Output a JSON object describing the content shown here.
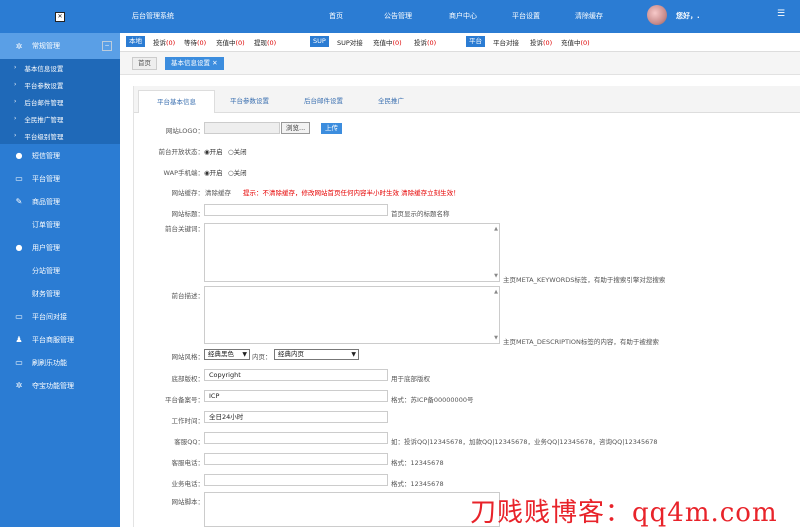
{
  "sidebar": {
    "logo_icon": "x-box-icon",
    "main": "常规管理",
    "sub": [
      "基本信息设置",
      "平台参数设置",
      "后台邮件管理",
      "全民推广管理",
      "平台级别管理"
    ],
    "items": [
      "短信管理",
      "平台管理",
      "商品管理",
      "订单管理",
      "用户管理",
      "分站管理",
      "财务管理",
      "平台间对接",
      "平台商服管理",
      "刷刷乐功能",
      "夺宝功能管理"
    ],
    "colors": {
      "bg": "#2b7cd3",
      "active": "#5a9fe6",
      "sub_bg": "#1f69b8"
    }
  },
  "topbar": {
    "title": "后台管理系统",
    "nav": [
      "首页",
      "公告管理",
      "商户中心",
      "平台设置",
      "清除缓存"
    ],
    "greeting": "您好，.",
    "menu_icon": "hamburger-icon"
  },
  "statusbar": {
    "local_tag": "本地",
    "local_items": [
      {
        "label": "投诉",
        "count": "(0)"
      },
      {
        "label": "等待",
        "count": "(0)"
      },
      {
        "label": "充值中",
        "count": "(0)"
      },
      {
        "label": "提现",
        "count": "(0)"
      }
    ],
    "sup_tag": "SUP",
    "sup_items": [
      {
        "label": "SUP对接",
        "count": ""
      },
      {
        "label": "充值中",
        "count": "(0)"
      },
      {
        "label": "投诉",
        "count": "(0)"
      }
    ],
    "plat_tag": "平台",
    "plat_items": [
      {
        "label": "平台对接",
        "count": ""
      },
      {
        "label": "投诉",
        "count": "(0)"
      },
      {
        "label": "充值中",
        "count": "(0)"
      }
    ]
  },
  "breadcrumb": {
    "home": "首页",
    "current": "基本信息设置 ✕"
  },
  "tabs": [
    "平台基本信息",
    "平台参数设置",
    "后台邮件设置",
    "全民推广"
  ],
  "form": {
    "logo_label": "网站LOGO：",
    "browse": "浏览...",
    "upload": "上传",
    "open_label": "前台开放状态：",
    "wap_label": "WAP手机端：",
    "radio_on": "开启",
    "radio_off": "关闭",
    "cache_label": "网站缓存：",
    "cache_value": "清除缓存",
    "cache_tip": "提示：不清除缓存，修改网站首页任何内容半小时生效 清除缓存立刻生效！",
    "title_label": "网站标题：",
    "title_hint": "首页显示的标题名称",
    "keywords_label": "前台关键词：",
    "keywords_hint": "主页META_KEYWORDS标签，有助于搜索引擎对您搜索",
    "desc_label": "前台描述：",
    "desc_hint": "主页META_DESCRIPTION标签的内容，有助于被搜索",
    "style_label": "网站风格：",
    "style_value": "经典黑色",
    "inner_label": "内页：",
    "inner_value": "经典内页",
    "copyright_label": "底部版权：",
    "copyright_value": "Copyright",
    "copyright_hint": "用于底部版权",
    "icp_label": "平台备案号：",
    "icp_value": "ICP",
    "icp_hint": "格式：苏ICP备00000000号",
    "hours_label": "工作时间：",
    "hours_value": "全日24小时",
    "qq_label": "客服QQ：",
    "qq_hint": "如：投诉QQ|12345678，加款QQ|12345678，业务QQ|12345678，咨询QQ|12345678",
    "phone_label": "客服电话：",
    "phone_hint": "格式：12345678",
    "biz_label": "业务电话：",
    "biz_hint": "格式：12345678",
    "script_label": "网站脚本："
  },
  "watermark": "刀贱贱博客：qq4m.com"
}
